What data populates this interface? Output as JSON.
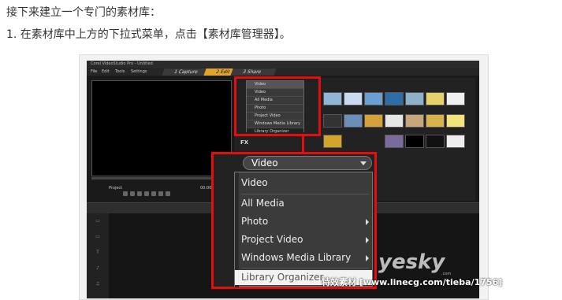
{
  "intro": "接下来建立一个专门的素材库：",
  "step1": "1. 在素材库中上方的下拉式菜单，点击【素材库管理器】。",
  "app": {
    "title": "Corel VideoStudio Pro - Untitled",
    "menu": [
      "File",
      "Edit",
      "Tools",
      "Settings"
    ],
    "steps": [
      "1 Capture",
      "2 Edit",
      "3 Share"
    ],
    "project_label": "Project",
    "timecode": "00:00",
    "fx_label": "FX"
  },
  "small_dropdown": {
    "header": "Video",
    "items": [
      "Video",
      "All Media",
      "Photo",
      "Project Video",
      "Windows Media Library",
      "Library Organizer"
    ]
  },
  "big_dropdown": {
    "header": "Video",
    "items": [
      {
        "label": "Video",
        "submenu": false
      },
      {
        "label": "All Media",
        "submenu": false
      },
      {
        "label": "Photo",
        "submenu": true
      },
      {
        "label": "Project Video",
        "submenu": true
      },
      {
        "label": "Windows Media Library",
        "submenu": true
      },
      {
        "label": "Library Organizer",
        "submenu": false
      }
    ]
  },
  "watermark": "yesky",
  "watermark_sub": ".com",
  "footer": "特效素材 [www.linecg.com/tieba/1756]",
  "colors": {
    "highlight_red": "#e50d0d",
    "edit_tab": "#e0a42a"
  }
}
